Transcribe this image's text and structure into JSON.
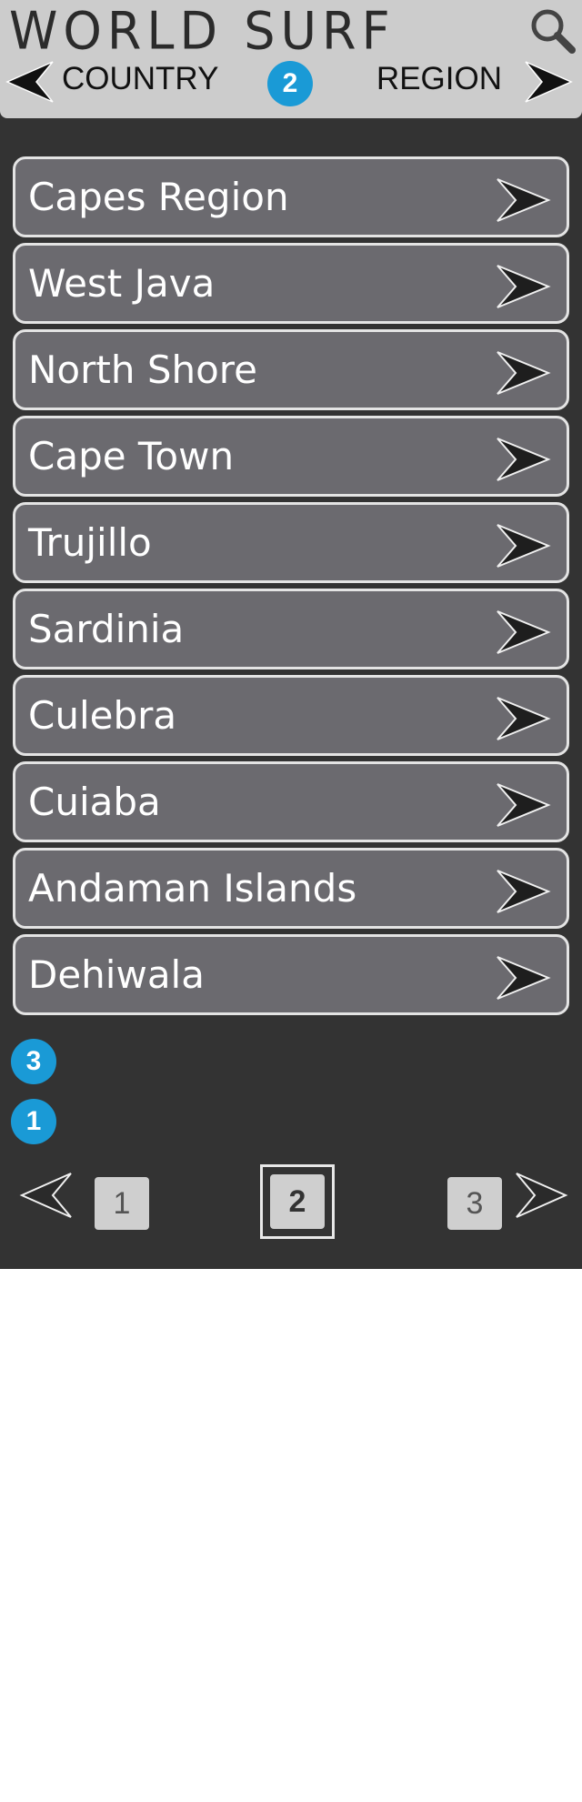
{
  "header": {
    "title": "WORLD SURF",
    "search_icon": "magnifier-icon",
    "prev_label": "COUNTRY",
    "next_label": "REGION",
    "badge": "2"
  },
  "regions": [
    {
      "label": "Capes Region"
    },
    {
      "label": "West Java"
    },
    {
      "label": "North Shore"
    },
    {
      "label": "Cape Town"
    },
    {
      "label": "Trujillo"
    },
    {
      "label": "Sardinia"
    },
    {
      "label": "Culebra"
    },
    {
      "label": "Cuiaba"
    },
    {
      "label": "Andaman Islands"
    },
    {
      "label": "Dehiwala"
    }
  ],
  "badges": {
    "list_badge": "3",
    "pager_badge": "1"
  },
  "pager": {
    "pages": [
      "1",
      "2",
      "3"
    ],
    "current": "2"
  },
  "colors": {
    "header_bg": "#cccccc",
    "app_bg": "#333333",
    "item_bg": "#6b6a6f",
    "badge": "#1a9ad6"
  }
}
